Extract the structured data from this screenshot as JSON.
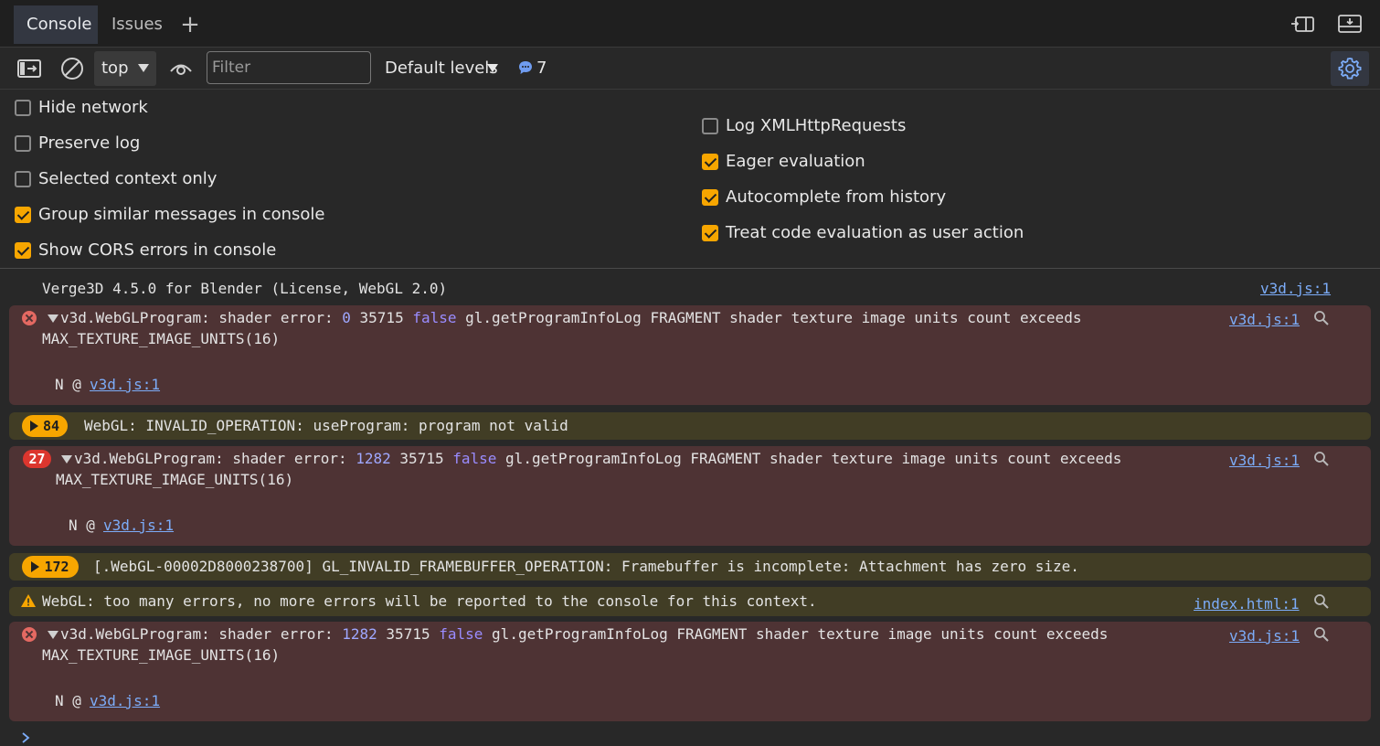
{
  "tabs": {
    "console": "Console",
    "issues": "Issues",
    "add": "+"
  },
  "toolbar": {
    "context": "top",
    "filter_placeholder": "Filter",
    "levels": "Default levels",
    "message_count": "7"
  },
  "settings": {
    "left": [
      {
        "label": "Hide network",
        "checked": false
      },
      {
        "label": "Preserve log",
        "checked": false
      },
      {
        "label": "Selected context only",
        "checked": false
      },
      {
        "label": "Group similar messages in console",
        "checked": true
      },
      {
        "label": "Show CORS errors in console",
        "checked": true
      }
    ],
    "right": [
      {
        "label": "Log XMLHttpRequests",
        "checked": false
      },
      {
        "label": "Eager evaluation",
        "checked": true
      },
      {
        "label": "Autocomplete from history",
        "checked": true
      },
      {
        "label": "Treat code evaluation as user action",
        "checked": true
      }
    ]
  },
  "messages": {
    "m0": {
      "text": "Verge3D 4.5.0 for Blender (License, WebGL 2.0)",
      "source": "v3d.js:1"
    },
    "m1": {
      "prefix": "v3d.WebGLProgram: shader error: ",
      "num1": "0",
      "num2": "35715",
      "kw": "false",
      "rest": "gl.getProgramInfoLog FRAGMENT shader texture image units count exceeds",
      "line2": "MAX_TEXTURE_IMAGE_UNITS(16)",
      "stack_fn": "N @",
      "stack_link": "v3d.js:1",
      "source": "v3d.js:1"
    },
    "m2": {
      "count": "84",
      "text": "WebGL: INVALID_OPERATION: useProgram: program not valid"
    },
    "m3": {
      "count": "27",
      "prefix": "v3d.WebGLProgram: shader error: ",
      "num1": "1282",
      "num2": "35715",
      "kw": "false",
      "rest": "gl.getProgramInfoLog FRAGMENT shader texture image units count exceeds",
      "line2": "MAX_TEXTURE_IMAGE_UNITS(16)",
      "stack_fn": "N @",
      "stack_link": "v3d.js:1",
      "source": "v3d.js:1"
    },
    "m4": {
      "count": "172",
      "text": "[.WebGL-00002D8000238700] GL_INVALID_FRAMEBUFFER_OPERATION: Framebuffer is incomplete: Attachment has zero size."
    },
    "m5": {
      "text": "WebGL: too many errors, no more errors will be reported to the console for this context.",
      "source": "index.html:1"
    },
    "m6": {
      "prefix": "v3d.WebGLProgram: shader error: ",
      "num1": "1282",
      "num2": "35715",
      "kw": "false",
      "rest": "gl.getProgramInfoLog FRAGMENT shader texture image units count exceeds",
      "line2": "MAX_TEXTURE_IMAGE_UNITS(16)",
      "stack_fn": "N @",
      "stack_link": "v3d.js:1",
      "source": "v3d.js:1"
    }
  },
  "colors": {
    "error_bg": "#4e3334",
    "warning_bg": "#413d25",
    "accent_orange": "#f7a600",
    "link_blue": "#7cacf8"
  },
  "icons": [
    "toggle-sidebar-icon",
    "clear-console-icon",
    "eye-icon",
    "message-bubble-icon",
    "gear-icon",
    "dock-icon",
    "undock-icon",
    "error-icon",
    "warning-icon",
    "search-icon",
    "chevron-right-icon"
  ]
}
